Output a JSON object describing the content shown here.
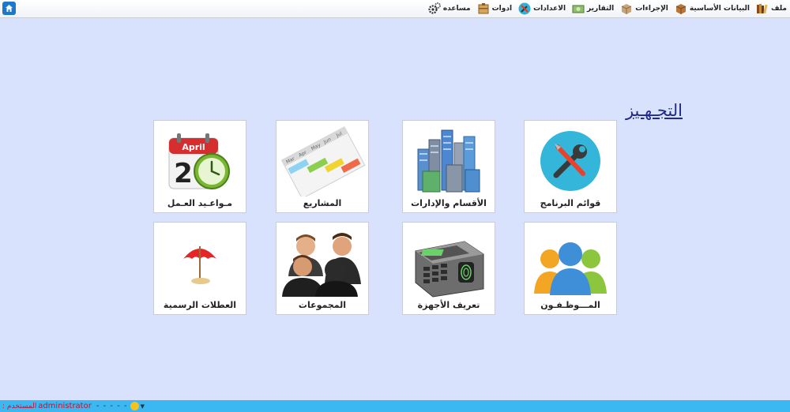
{
  "menubar": {
    "items": [
      {
        "label": "ملف",
        "icon": "books-icon"
      },
      {
        "label": "البيانات الأساسية",
        "icon": "box-icon"
      },
      {
        "label": "الإجراءات",
        "icon": "box-icon"
      },
      {
        "label": "التقارير",
        "icon": "money-icon"
      },
      {
        "label": "الاعدادات",
        "icon": "wrench-icon"
      },
      {
        "label": "ادوات",
        "icon": "tools-box-icon"
      },
      {
        "label": "مساعده",
        "icon": "gears-icon"
      }
    ]
  },
  "page": {
    "title": "التجـهـيز"
  },
  "tiles": [
    {
      "label": "قوائم البرنامج",
      "icon": "wrench-screwdriver-icon"
    },
    {
      "label": "الأقسام والإدارات",
      "icon": "buildings-icon"
    },
    {
      "label": "المشاريع",
      "icon": "gantt-chart-icon"
    },
    {
      "label": "مـواعـيد العـمل",
      "icon": "calendar-clock-icon"
    },
    {
      "label": "المـــوظـفـون",
      "icon": "people-icon"
    },
    {
      "label": "تعريف الأجهزة",
      "icon": "fingerprint-device-icon"
    },
    {
      "label": "المجموعات",
      "icon": "group-icon"
    },
    {
      "label": "العطلات الرسمية",
      "icon": "umbrella-icon"
    }
  ],
  "calendar": {
    "month": "April",
    "day": "2"
  },
  "gantt": {
    "months": [
      "Mar",
      "Apr",
      "May",
      "Jun",
      "Jul"
    ]
  },
  "statusbar": {
    "user_label": "المستخدم :",
    "user": "administrator",
    "dashes": "- - - - -"
  },
  "colors": {
    "background": "#d9e2fd",
    "statusbar": "#3bb8f2",
    "title": "#1f2a8c",
    "user_text": "#c8102e"
  }
}
